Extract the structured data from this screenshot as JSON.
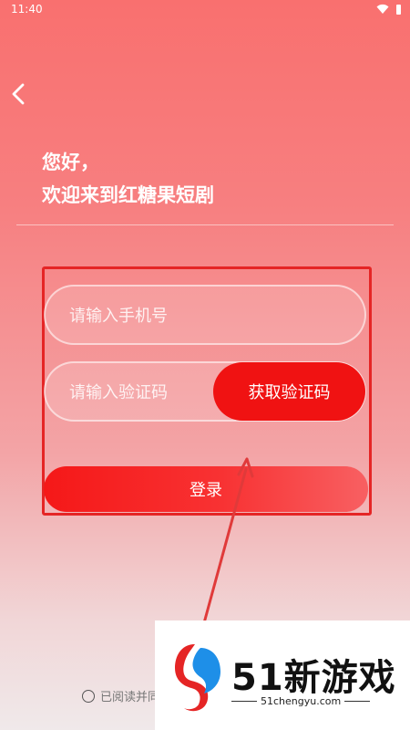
{
  "status_bar": {
    "time": "11:40"
  },
  "header": {
    "greeting_line1": "您好，",
    "greeting_line2": "欢迎来到红糖果短剧"
  },
  "form": {
    "phone_placeholder": "请输入手机号",
    "code_placeholder": "请输入验证码",
    "get_code_label": "获取验证码",
    "login_label": "登录"
  },
  "agreement": {
    "text": "已阅读并同"
  },
  "watermark": {
    "title": "51新游戏",
    "url": "51chengyu.com"
  },
  "colors": {
    "accent": "#f01212",
    "frame": "#e52525"
  }
}
